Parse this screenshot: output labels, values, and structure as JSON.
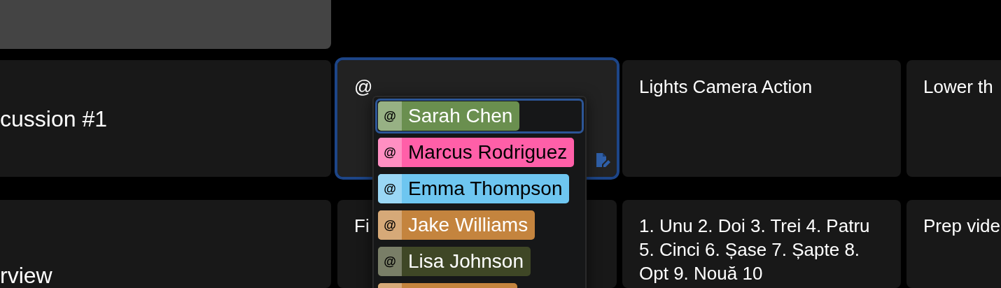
{
  "rows": [
    {
      "cells": [
        {
          "kind": "title",
          "text": "cussion #1"
        },
        {
          "kind": "editor",
          "text": "@",
          "focused": true
        },
        {
          "kind": "text",
          "text": "Lights Camera Action"
        },
        {
          "kind": "text",
          "text": "Lower th"
        }
      ]
    },
    {
      "cells": [
        {
          "kind": "title",
          "text": "rview"
        },
        {
          "kind": "text",
          "text": "Fi"
        },
        {
          "kind": "text",
          "text": "1. Unu 2. Doi 3. Trei 4. Patru 5. Cinci 6. Șase 7. Șapte 8. Opt 9. Nouă 10"
        },
        {
          "kind": "text",
          "text": "Prep vide"
        }
      ]
    }
  ],
  "mention_menu": {
    "items": [
      {
        "symbol": "@",
        "name": "Sarah Chen",
        "color": "#6a8f4f",
        "selected": true
      },
      {
        "symbol": "@",
        "name": "Marcus Rodriguez",
        "color": "#ff5fa8",
        "selected": false
      },
      {
        "symbol": "@",
        "name": "Emma Thompson",
        "color": "#6ec6f0",
        "selected": false
      },
      {
        "symbol": "@",
        "name": "Jake Williams",
        "color": "#c4843e",
        "selected": false
      },
      {
        "symbol": "@",
        "name": "Lisa Johnson",
        "color": "#3f4726",
        "selected": false
      },
      {
        "color": "#c4843e",
        "selected": false
      }
    ]
  }
}
